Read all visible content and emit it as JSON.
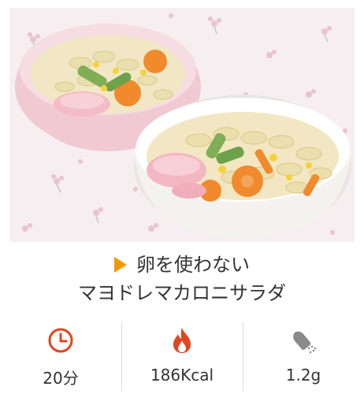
{
  "recipe": {
    "title_line1": "卵を使わない",
    "title_line2": "マヨドレマカロニサラダ"
  },
  "stats": [
    {
      "icon": "clock-icon",
      "value": "20分"
    },
    {
      "icon": "flame-icon",
      "value": "186Kcal"
    },
    {
      "icon": "salt-shaker-icon",
      "value": "1.2g"
    }
  ],
  "colors": {
    "accent": "#f39800",
    "icon_red": "#e0461f",
    "icon_gray": "#8a8a8a",
    "divider": "#d9d9d9"
  }
}
